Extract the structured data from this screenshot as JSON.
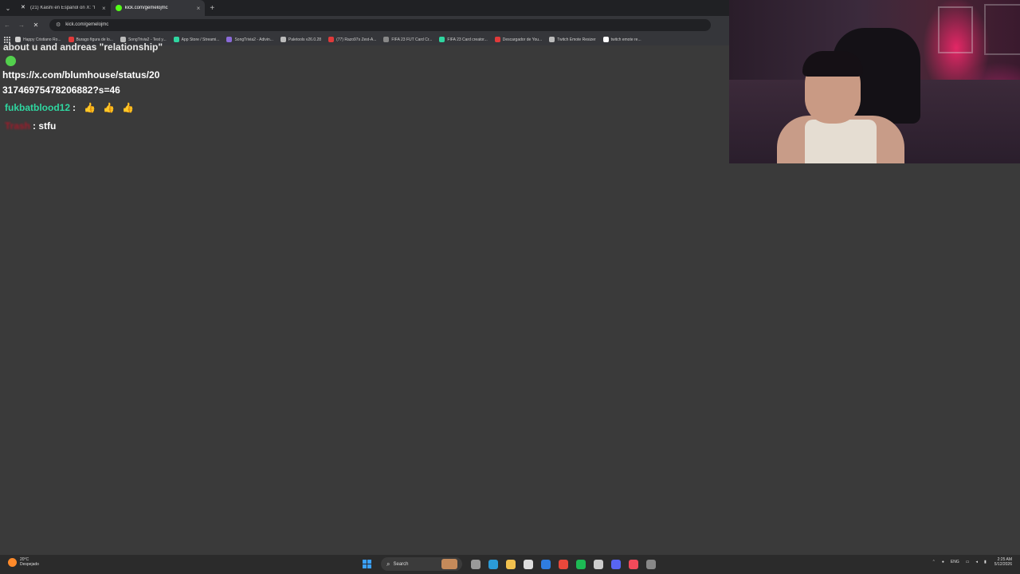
{
  "browser": {
    "tabs": [
      {
        "label": "(21) Kaishi en Español on X: \"I",
        "active": false,
        "icon": "x-logo-icon"
      },
      {
        "label": "kick.com/gemelojmc",
        "active": true,
        "icon": "kick-icon"
      }
    ],
    "address": "kick.com/gemelojmc",
    "bookmarks": [
      {
        "label": "Happy Cristiano Ro...",
        "color": "#d0d0d0"
      },
      {
        "label": "Burago figura de lo...",
        "color": "#e03a3a"
      },
      {
        "label": "SongTrivia2 - Test y...",
        "color": "#bbbbbb"
      },
      {
        "label": "App Store / Streami...",
        "color": "#2fd6a0"
      },
      {
        "label": "SongTrivia2 - Adivin...",
        "color": "#8a6ad8"
      },
      {
        "label": "Paletools v26.0.28",
        "color": "#bbbbbb"
      },
      {
        "label": "(77) Razo97s Zest-A...",
        "color": "#e03a3a"
      },
      {
        "label": "FIFA 23 FUT Card Cr...",
        "color": "#888888"
      },
      {
        "label": "FIFA 23 Card creator...",
        "color": "#2fd6a0"
      },
      {
        "label": "Descargador de You...",
        "color": "#e03a3a"
      },
      {
        "label": "Twitch Emote Resizer",
        "color": "#bbbbbb"
      },
      {
        "label": "twitch emote re...",
        "color": "#ffffff"
      }
    ]
  },
  "chat": {
    "top_text": "about u and andreas \"relationship\"",
    "link_line1": "https://x.com/blumhouse/status/20",
    "link_line2": "31746975478206882?s=46",
    "msg3_user": "fukbatblood12",
    "msg3_colon": ":",
    "msg3_emotes": [
      "👍",
      "👍",
      "👍"
    ],
    "msg4_user": "Trash",
    "msg4_text": ": stfu"
  },
  "taskbar": {
    "temp": "20°C",
    "weather": "Despejado",
    "search": "Search",
    "lang": "ENG",
    "time": "2:25 AM",
    "date": "5/12/2026",
    "icons": [
      {
        "name": "task-view-icon",
        "color": "#9a9a9a"
      },
      {
        "name": "edge-icon",
        "color": "#2b9bd8"
      },
      {
        "name": "file-explorer-icon",
        "color": "#f2c14e"
      },
      {
        "name": "store-icon",
        "color": "#dddddd"
      },
      {
        "name": "mail-icon",
        "color": "#2f7de0"
      },
      {
        "name": "chrome-icon",
        "color": "#e9483b"
      },
      {
        "name": "spotify-icon",
        "color": "#1db954"
      },
      {
        "name": "obs-icon",
        "color": "#cccccc"
      },
      {
        "name": "discord-icon",
        "color": "#5865f2"
      },
      {
        "name": "music-icon",
        "color": "#f24a5a"
      },
      {
        "name": "app-icon",
        "color": "#888888"
      }
    ]
  }
}
